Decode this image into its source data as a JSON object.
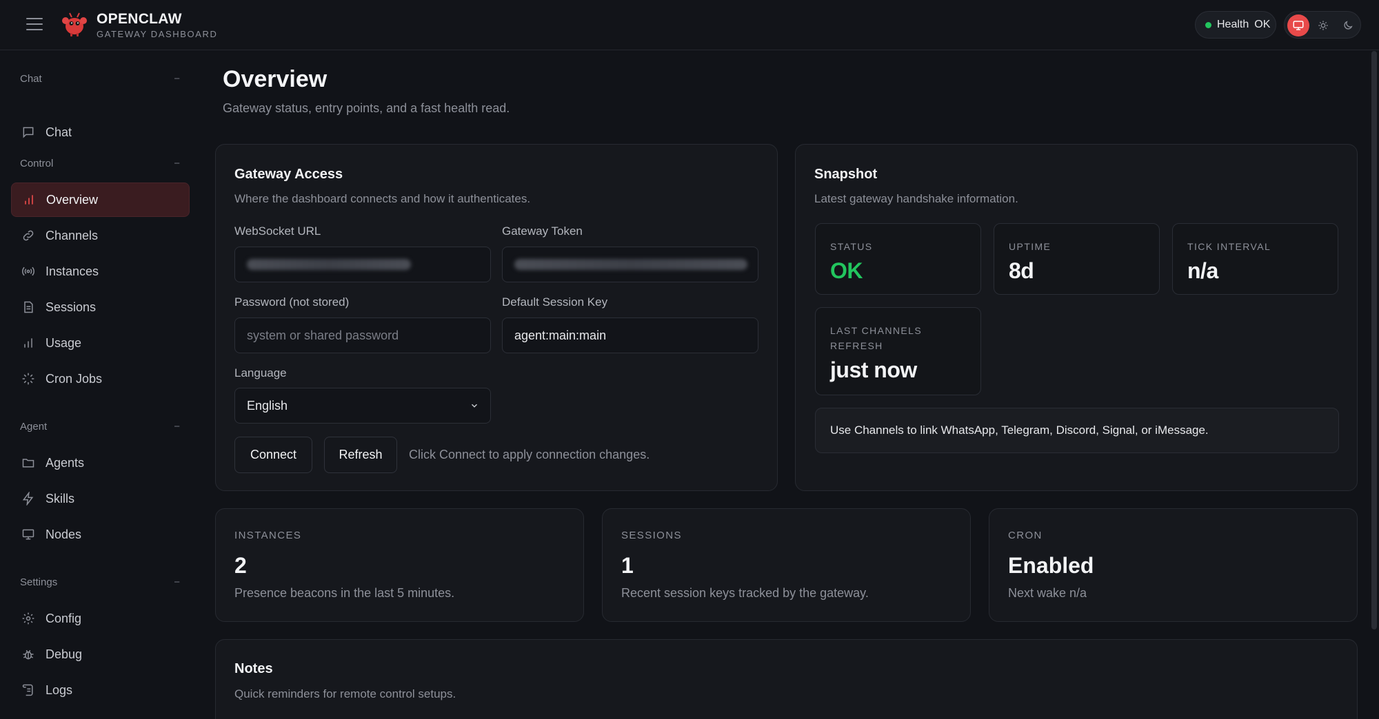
{
  "header": {
    "brand_title": "OPENCLAW",
    "brand_sub": "GATEWAY DASHBOARD",
    "health_label": "Health",
    "health_value": "OK"
  },
  "sidebar": {
    "sections": [
      {
        "label": "Chat",
        "collapse": "−",
        "items": [
          {
            "label": "Chat",
            "icon": "message-icon"
          }
        ]
      },
      {
        "label": "Control",
        "collapse": "−",
        "items": [
          {
            "label": "Overview",
            "icon": "bar-chart-icon",
            "active": true
          },
          {
            "label": "Channels",
            "icon": "link-icon"
          },
          {
            "label": "Instances",
            "icon": "broadcast-icon"
          },
          {
            "label": "Sessions",
            "icon": "document-icon"
          },
          {
            "label": "Usage",
            "icon": "bar-chart-icon"
          },
          {
            "label": "Cron Jobs",
            "icon": "loader-icon"
          }
        ]
      },
      {
        "label": "Agent",
        "collapse": "−",
        "items": [
          {
            "label": "Agents",
            "icon": "folder-icon"
          },
          {
            "label": "Skills",
            "icon": "bolt-icon"
          },
          {
            "label": "Nodes",
            "icon": "monitor-icon"
          }
        ]
      },
      {
        "label": "Settings",
        "collapse": "−",
        "items": [
          {
            "label": "Config",
            "icon": "gear-icon"
          },
          {
            "label": "Debug",
            "icon": "bug-icon"
          },
          {
            "label": "Logs",
            "icon": "scroll-icon"
          }
        ]
      }
    ]
  },
  "page": {
    "title": "Overview",
    "subtitle": "Gateway status, entry points, and a fast health read."
  },
  "gateway_access": {
    "title": "Gateway Access",
    "subtitle": "Where the dashboard connects and how it authenticates.",
    "websocket_label": "WebSocket URL",
    "token_label": "Gateway Token",
    "password_label": "Password (not stored)",
    "password_placeholder": "system or shared password",
    "session_key_label": "Default Session Key",
    "session_key_value": "agent:main:main",
    "language_label": "Language",
    "language_value": "English",
    "connect_label": "Connect",
    "refresh_label": "Refresh",
    "hint": "Click Connect to apply connection changes."
  },
  "snapshot": {
    "title": "Snapshot",
    "subtitle": "Latest gateway handshake information.",
    "status_label": "STATUS",
    "status_value": "OK",
    "uptime_label": "UPTIME",
    "uptime_value": "8d",
    "tick_label": "TICK INTERVAL",
    "tick_value": "n/a",
    "refresh_label_line1": "LAST CHANNELS",
    "refresh_label_line2": "REFRESH",
    "refresh_value": "just now",
    "callout": "Use Channels to link WhatsApp, Telegram, Discord, Signal, or iMessage."
  },
  "metrics": [
    {
      "label": "INSTANCES",
      "value": "2",
      "sub": "Presence beacons in the last 5 minutes."
    },
    {
      "label": "SESSIONS",
      "value": "1",
      "sub": "Recent session keys tracked by the gateway."
    },
    {
      "label": "CRON",
      "value": "Enabled",
      "sub": "Next wake n/a"
    }
  ],
  "notes": {
    "title": "Notes",
    "subtitle": "Quick reminders for remote control setups."
  },
  "colors": {
    "accent": "#e84a4a",
    "ok": "#22c55e",
    "background": "#111318",
    "card": "#16181d"
  }
}
